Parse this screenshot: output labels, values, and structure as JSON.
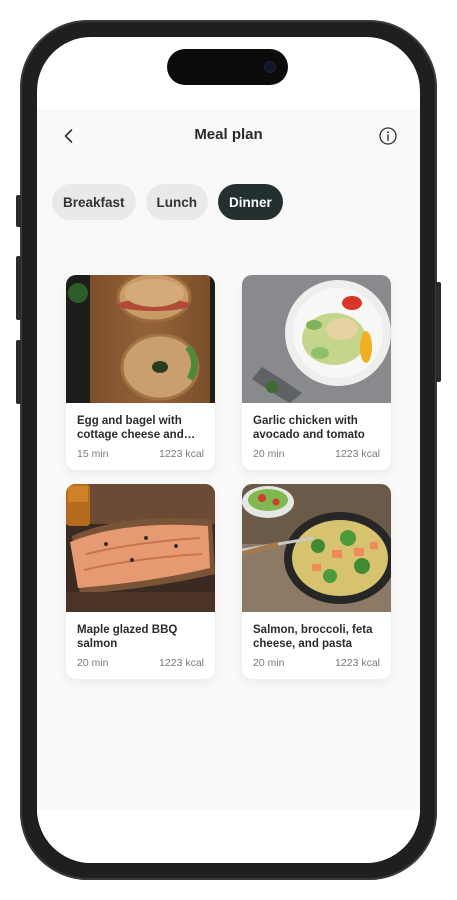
{
  "header": {
    "title": "Meal plan",
    "back_icon": "chevron-left-icon",
    "info_icon": "info-circle-icon"
  },
  "tabs": [
    {
      "label": "Breakfast",
      "active": false
    },
    {
      "label": "Lunch",
      "active": false
    },
    {
      "label": "Dinner",
      "active": true
    }
  ],
  "meals": [
    {
      "name": "Egg and bagel with cottage cheese and tomato",
      "time": "15 min",
      "kcal": "1223 kcal",
      "image": "bagel-photo"
    },
    {
      "name": "Garlic chicken with avocado and tomato",
      "time": "20 min",
      "kcal": "1223 kcal",
      "image": "chicken-salad-photo"
    },
    {
      "name": "Maple glazed BBQ salmon",
      "time": "20 min",
      "kcal": "1223 kcal",
      "image": "salmon-photo"
    },
    {
      "name": "Salmon, broccoli, feta cheese, and pasta",
      "time": "20 min",
      "kcal": "1223 kcal",
      "image": "pasta-photo"
    }
  ],
  "colors": {
    "active_tab": "#243030",
    "inactive_tab": "#e9e9e9",
    "screen_bg": "#f9f9f9"
  }
}
